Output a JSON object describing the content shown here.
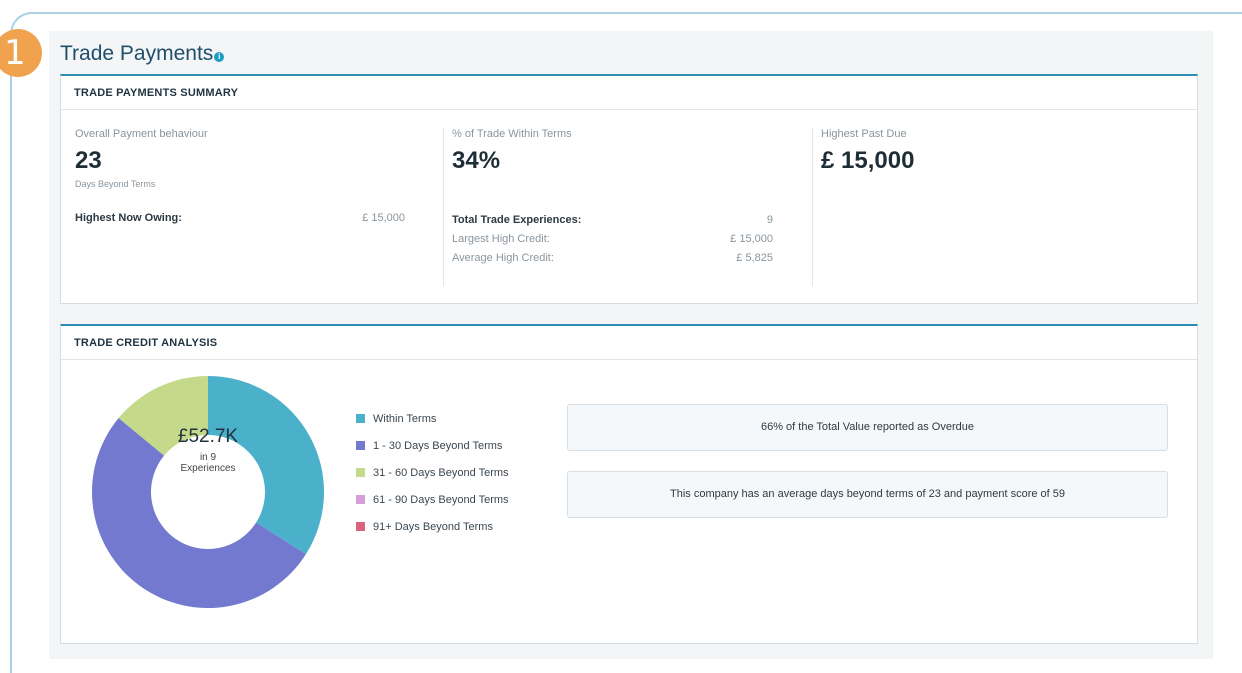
{
  "step_badge": "1",
  "section": {
    "title": "Trade Payments",
    "help_icon": "info-icon"
  },
  "summary": {
    "header": "TRADE PAYMENTS SUMMARY",
    "overall": {
      "label": "Overall Payment behaviour",
      "value": "23",
      "sub": "Days Beyond Terms",
      "highest_now_owing_label": "Highest Now Owing:",
      "highest_now_owing_value": "£ 15,000"
    },
    "within_terms": {
      "label": "% of Trade Within Terms",
      "value": "34%",
      "total_exp_label": "Total Trade Experiences:",
      "total_exp_value": "9",
      "largest_label": "Largest High Credit:",
      "largest_value": "£ 15,000",
      "average_label": "Average High Credit:",
      "average_value": "£ 5,825"
    },
    "past_due": {
      "label": "Highest Past Due",
      "value": "£ 15,000"
    }
  },
  "analysis": {
    "header": "TRADE CREDIT ANALYSIS",
    "donut_total": "£52.7K",
    "donut_sub1": "in 9",
    "donut_sub2": "Experiences",
    "legend": [
      {
        "label": "Within Terms",
        "color": "#4bb1cb"
      },
      {
        "label": "1 - 30 Days Beyond Terms",
        "color": "#7479d0"
      },
      {
        "label": "31 - 60 Days Beyond Terms",
        "color": "#c5d98a"
      },
      {
        "label": "61 - 90 Days Beyond Terms",
        "color": "#d79ed9"
      },
      {
        "label": "91+ Days Beyond Terms",
        "color": "#d9637f"
      }
    ],
    "info_1": "66% of the Total Value reported as Overdue",
    "info_2": "This company has an average days beyond terms of 23 and payment score of 59"
  },
  "chart_data": {
    "type": "pie",
    "categories": [
      "Within Terms",
      "1 - 30 Days Beyond Terms",
      "31 - 60 Days Beyond Terms",
      "61 - 90 Days Beyond Terms",
      "91+ Days Beyond Terms"
    ],
    "values": [
      34,
      52,
      14,
      0,
      0
    ],
    "colors": [
      "#4bb1cb",
      "#7479d0",
      "#c5d98a",
      "#d79ed9",
      "#d9637f"
    ]
  }
}
